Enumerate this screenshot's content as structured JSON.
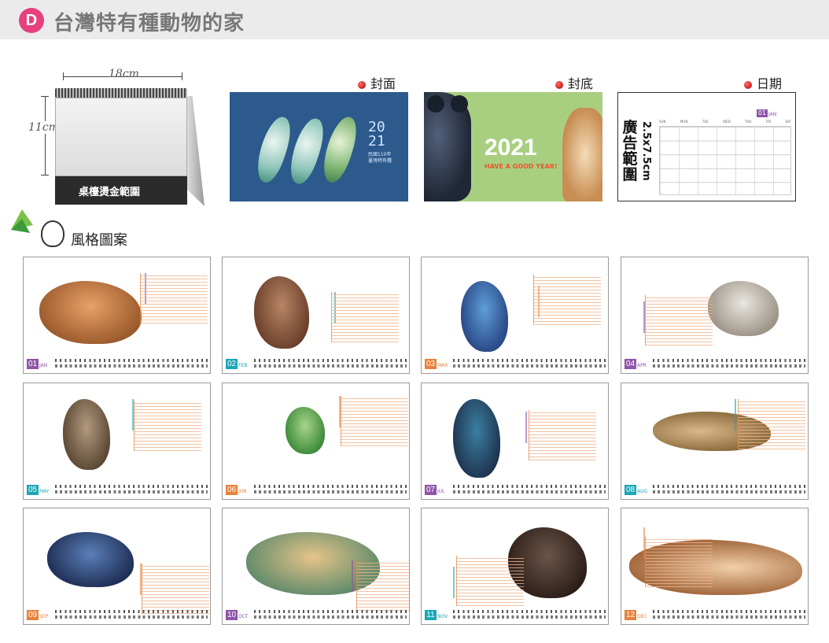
{
  "header": {
    "badge": "D",
    "title": "台灣特有種動物的家"
  },
  "desk": {
    "width_label": "18cm",
    "height_label": "11cm",
    "band_text": "桌檯燙金範圍"
  },
  "labels": {
    "cover": "封面",
    "back": "封底",
    "date": "日期"
  },
  "cover": {
    "year_top": "20",
    "year_bottom": "21",
    "small_text": "民國110年 臺灣特有種"
  },
  "back": {
    "year": "2021",
    "subtitle": "HAVE A GOOD YEAR!"
  },
  "date_card": {
    "vertical_main": "廣告範圍",
    "vertical_size": "2.5x7.5cm",
    "month_num": "01",
    "month_name": "JAN",
    "weekdays": [
      "SUN",
      "MON",
      "TUE",
      "WED",
      "THU",
      "FRI",
      "SAT"
    ]
  },
  "style": {
    "title": "風格圖案"
  },
  "months": [
    {
      "num": "01",
      "name": "JAN",
      "color": "#8e55a8"
    },
    {
      "num": "02",
      "name": "FEB",
      "color": "#1aa6b7"
    },
    {
      "num": "03",
      "name": "MAR",
      "color": "#e8823c"
    },
    {
      "num": "04",
      "name": "APR",
      "color": "#8e55a8"
    },
    {
      "num": "05",
      "name": "MAY",
      "color": "#1aa6b7"
    },
    {
      "num": "06",
      "name": "JUN",
      "color": "#e8823c"
    },
    {
      "num": "07",
      "name": "JUL",
      "color": "#8e55a8"
    },
    {
      "num": "08",
      "name": "AUG",
      "color": "#1aa6b7"
    },
    {
      "num": "09",
      "name": "SEP",
      "color": "#e8823c"
    },
    {
      "num": "10",
      "name": "OCT",
      "color": "#8e55a8"
    },
    {
      "num": "11",
      "name": "NOV",
      "color": "#1aa6b7"
    },
    {
      "num": "12",
      "name": "DEC",
      "color": "#e8823c"
    }
  ],
  "colors": {
    "accent_pink": "#e6417e",
    "cover_blue": "#2c5a8c",
    "back_green": "#a8cf80"
  }
}
